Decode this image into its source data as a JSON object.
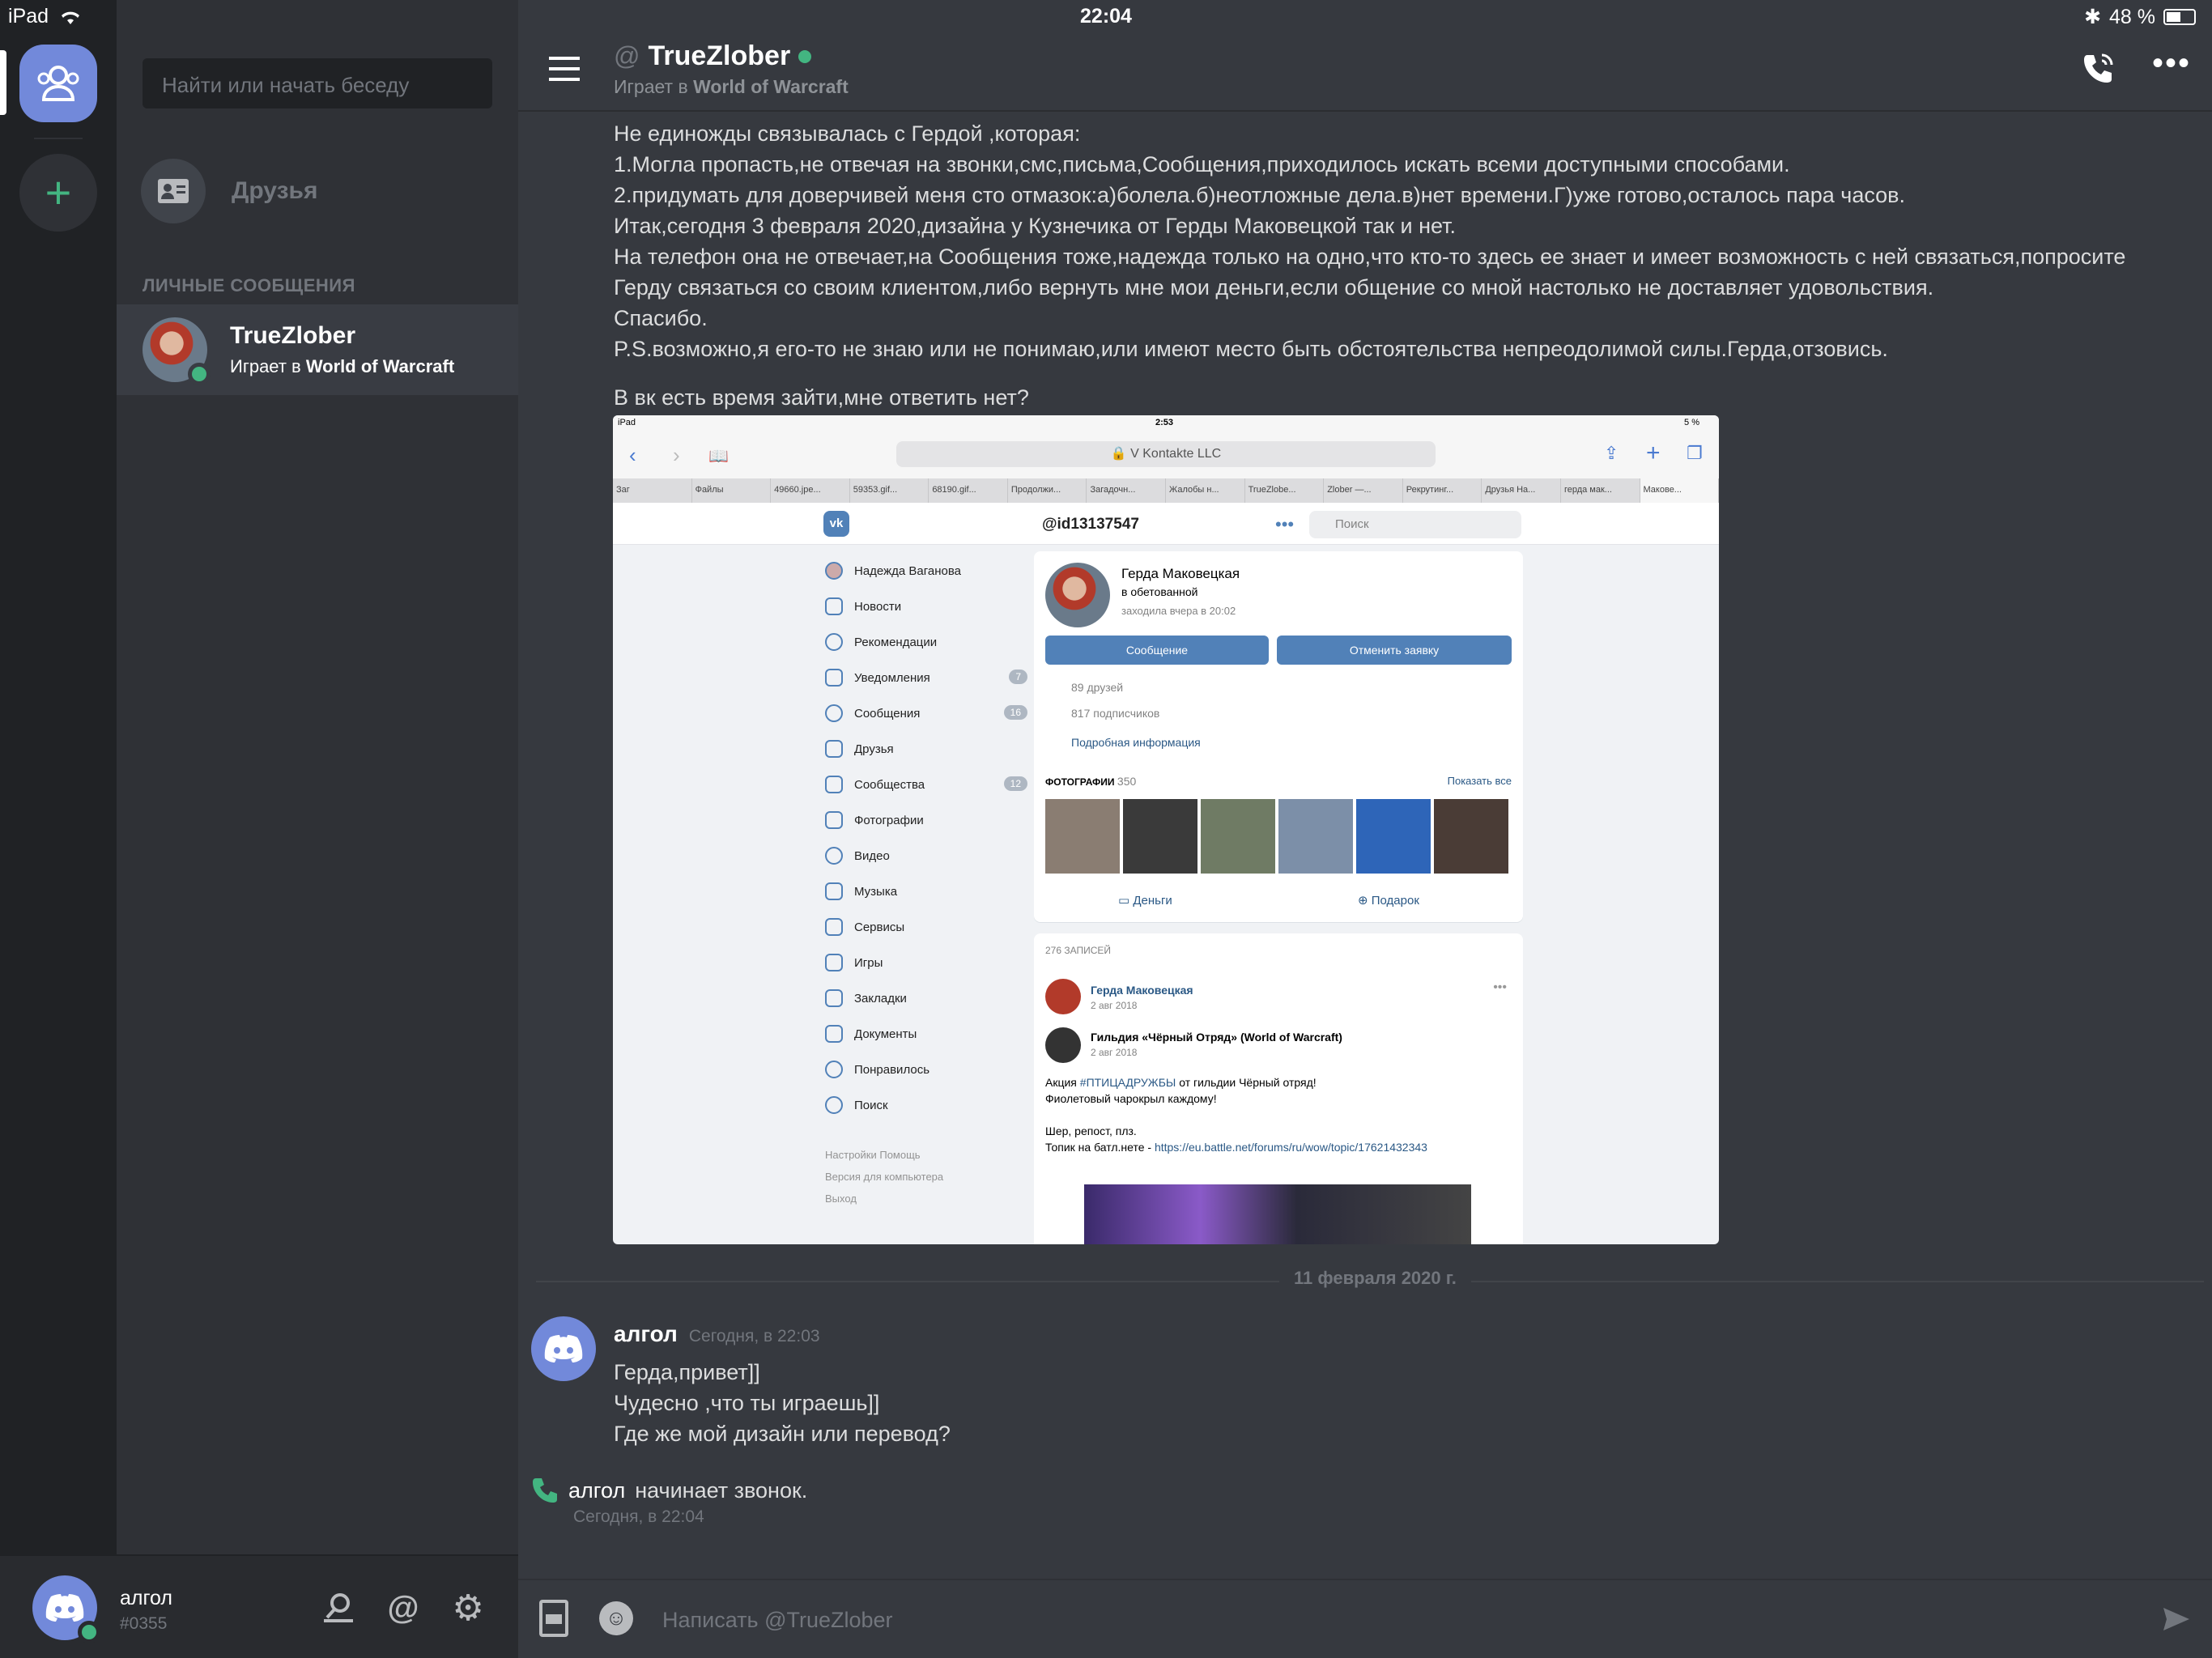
{
  "status_bar": {
    "device": "iPad",
    "time": "22:04",
    "battery": "48 %"
  },
  "search": {
    "placeholder": "Найти или начать беседу"
  },
  "friends_label": "Друзья",
  "dm_header": "ЛИЧНЫЕ СООБЩЕНИЯ",
  "dm": {
    "name": "TrueZlober",
    "activity_prefix": "Играет в ",
    "activity_game": "World of Warcraft"
  },
  "user": {
    "name": "алгол",
    "tag": "#0355"
  },
  "channel": {
    "name": "TrueZlober",
    "activity_prefix": "Играет в ",
    "activity_game": "World of Warcraft"
  },
  "message1": {
    "lines": [
      "Не единожды связывалась с Гердой ,которая:",
      "1.Могла пропасть,не отвечая на звонки,смс,письма,Сообщения,приходилось искать всеми доступными способами.",
      "2.придумать для доверчивей меня сто отмазок:а)болела.б)неотложные дела.в)нет времени.Г)уже готово,осталось пара часов.",
      "Итак,сегодня 3 февраля 2020,дизайна у Кузнечика от Герды Маковецкой так и нет.",
      "На телефон она не отвечает,на Сообщения тоже,надежда только на одно,что кто-то здесь ее знает и имеет возможность с ней связаться,попросите",
      "Герду связаться со своим клиентом,либо вернуть мне мои деньги,если общение со мной настолько не доставляет удовольствия.",
      "Спасибо.",
      "P.S.возможно,я его-то не знаю или не понимаю,или имеют место быть обстоятельства непреодолимой силы.Герда,отзовись."
    ],
    "question": "В вк есть время зайти,мне ответить нет?"
  },
  "vk": {
    "time": "2:53",
    "device": "iPad",
    "battery": "5 %",
    "url": "V Kontakte LLC",
    "tabs": [
      "Заг",
      "Файлы",
      "49660.jpe...",
      "59353.gif...",
      "68190.gif...",
      "Продолжи...",
      "Загадочн...",
      "Жалобы н...",
      "TrueZlobe...",
      "Zlober —...",
      "Рекрутинг...",
      "Друзья На...",
      "герда мак...",
      "Макове..."
    ],
    "profile_id": "@id13137547",
    "search": "Поиск",
    "nav": [
      {
        "label": "Надежда Ваганова",
        "badge": ""
      },
      {
        "label": "Новости",
        "badge": ""
      },
      {
        "label": "Рекомендации",
        "badge": ""
      },
      {
        "label": "Уведомления",
        "badge": "7"
      },
      {
        "label": "Сообщения",
        "badge": "16"
      },
      {
        "label": "Друзья",
        "badge": ""
      },
      {
        "label": "Сообщества",
        "badge": "12"
      },
      {
        "label": "Фотографии",
        "badge": ""
      },
      {
        "label": "Видео",
        "badge": ""
      },
      {
        "label": "Музыка",
        "badge": ""
      },
      {
        "label": "Сервисы",
        "badge": ""
      },
      {
        "label": "Игры",
        "badge": ""
      },
      {
        "label": "Закладки",
        "badge": ""
      },
      {
        "label": "Документы",
        "badge": ""
      },
      {
        "label": "Понравилось",
        "badge": ""
      },
      {
        "label": "Поиск",
        "badge": ""
      }
    ],
    "footer": [
      "Настройки   Помощь",
      "Версия для компьютера",
      "Выход"
    ],
    "name": "Герда Маковецкая",
    "status": "в обетованной",
    "seen": "заходила вчера в 20:02",
    "btn_message": "Сообщение",
    "btn_cancel": "Отменить заявку",
    "friends": "89 друзей",
    "subscribers": "817 подписчиков",
    "details": "Подробная информация",
    "photos_label": "ФОТОГРАФИИ",
    "photos_count": "350",
    "show_all": "Показать все",
    "money": "Деньги",
    "gift": "Подарок",
    "posts_count": "276 ЗАПИСЕЙ",
    "post_author": "Герда Маковецкая",
    "post_date": "2 авг 2018",
    "repost_source": "Гильдия «Чёрный Отряд» (World of Warcraft)",
    "repost_date": "2 авг 2018",
    "post_line1_pre": "Акция ",
    "post_hashtag": "#ПТИЦАДРУЖБЫ",
    "post_line1_post": " от гильдии Чёрный отряд!",
    "post_line2": "Фиолетовый чарокрыл каждому!",
    "post_line3": "Шер, репост, плз.",
    "post_line4": "Топик на батл.нете - ",
    "post_link": "https://eu.battle.net/forums/ru/wow/topic/17621432343"
  },
  "divider_date": "11 февраля 2020 г.",
  "message2": {
    "author": "алгол",
    "time": "Сегодня, в 22:03",
    "lines": [
      "Герда,привет]]",
      "Чудесно ,что ты играешь]]",
      "Где же мой дизайн или перевод?"
    ]
  },
  "call": {
    "author": "алгол",
    "text": "начинает звонок.",
    "time": "Сегодня, в 22:04"
  },
  "composer": {
    "placeholder": "Написать @TrueZlober"
  }
}
